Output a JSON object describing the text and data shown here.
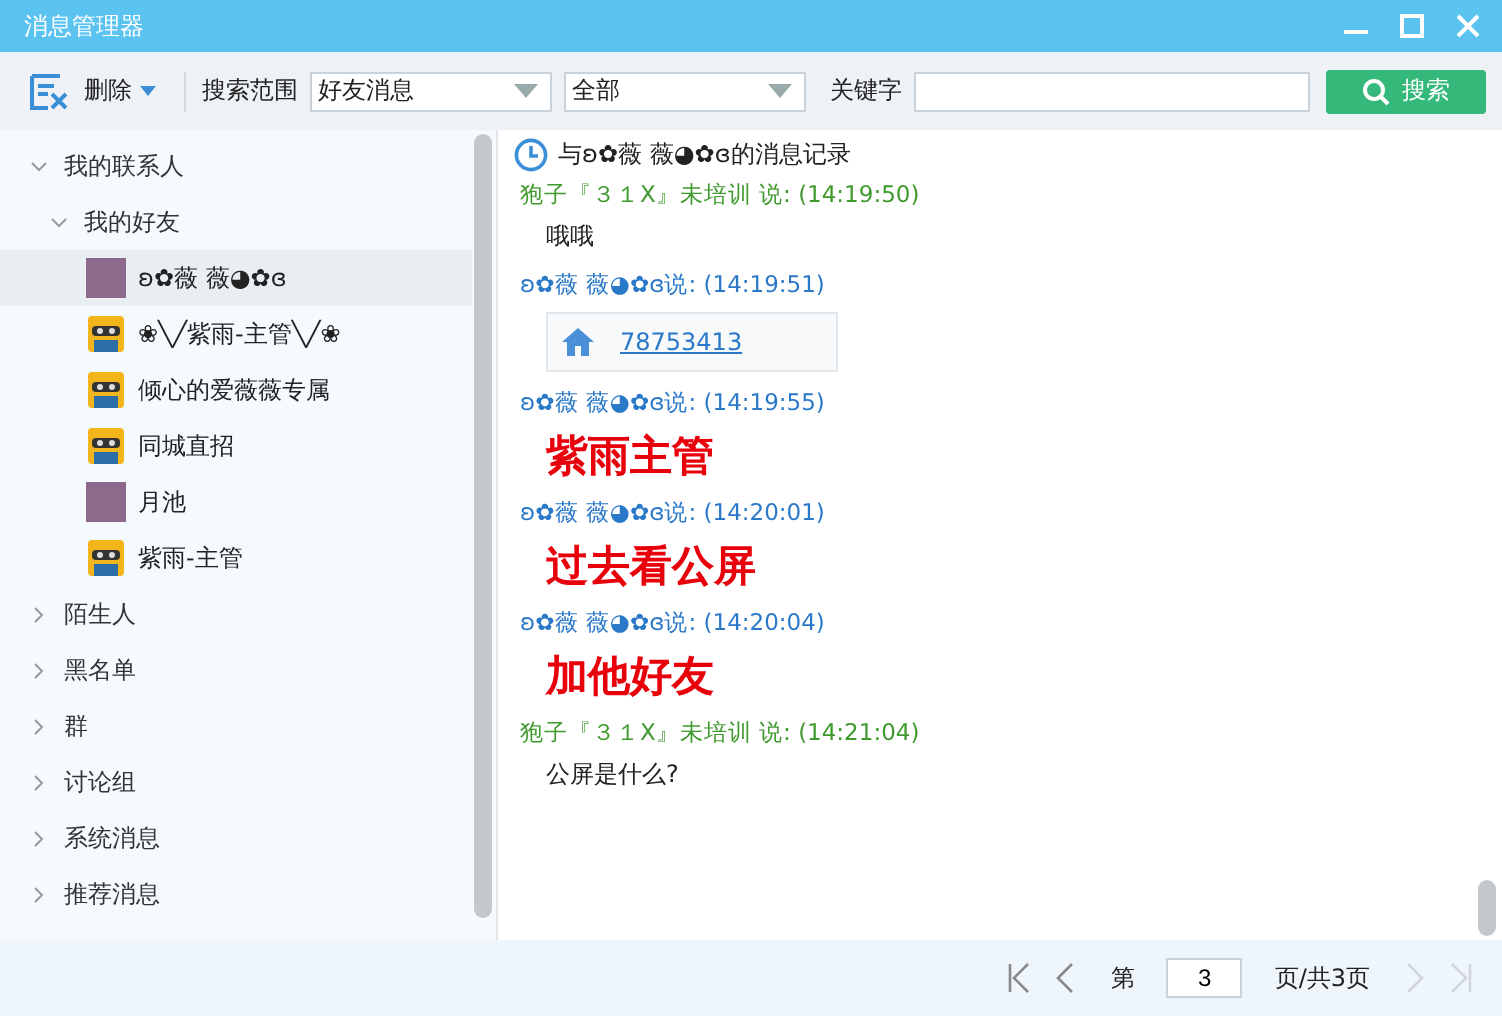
{
  "window": {
    "title": "消息管理器"
  },
  "toolbar": {
    "delete_label": "删除",
    "scope_label": "搜索范围",
    "scope_value": "好友消息",
    "filter_value": "全部",
    "keyword_label": "关键字",
    "search_button": "搜索"
  },
  "tree": [
    {
      "label": "我的联系人",
      "expanded": true,
      "children": [
        {
          "label": "我的好友",
          "expanded": true,
          "contacts": [
            {
              "name": "ʚ✿薇 薇◕✿ɞ",
              "kind": "photo",
              "selected": true
            },
            {
              "name": "❀╲╱紫雨-主管╲╱❀",
              "kind": "default",
              "selected": false
            },
            {
              "name": "倾心的爱薇薇专属",
              "kind": "default",
              "selected": false
            },
            {
              "name": "同城直招",
              "kind": "default",
              "selected": false
            },
            {
              "name": "月池",
              "kind": "photo",
              "selected": false
            },
            {
              "name": "紫雨-主管",
              "kind": "default",
              "selected": false
            }
          ]
        }
      ]
    },
    {
      "label": "陌生人",
      "expanded": false
    },
    {
      "label": "黑名单",
      "expanded": false
    },
    {
      "label": "群",
      "expanded": false
    },
    {
      "label": "讨论组",
      "expanded": false
    },
    {
      "label": "系统消息",
      "expanded": false
    },
    {
      "label": "推荐消息",
      "expanded": false
    }
  ],
  "history": {
    "title": "与ʚ✿薇 薇◕✿ɞ的消息记录",
    "messages": [
      {
        "sender": "狍子『３１X』未培训 说: (14:19:50)",
        "color": "#3f9a2e",
        "kind": "text",
        "content": "哦哦"
      },
      {
        "sender": "ʚ✿薇 薇◕✿ɞ说: (14:19:51)",
        "color": "#2a78c8",
        "kind": "link",
        "content": "78753413"
      },
      {
        "sender": "ʚ✿薇 薇◕✿ɞ说: (14:19:55)",
        "color": "#2a78c8",
        "kind": "big",
        "content": "紫雨主管"
      },
      {
        "sender": "ʚ✿薇 薇◕✿ɞ说: (14:20:01)",
        "color": "#2a78c8",
        "kind": "big",
        "content": "过去看公屏"
      },
      {
        "sender": "ʚ✿薇 薇◕✿ɞ说: (14:20:04)",
        "color": "#2a78c8",
        "kind": "big",
        "content": "加他好友"
      },
      {
        "sender": "狍子『３１X』未培训 说: (14:21:04)",
        "color": "#3f9a2e",
        "kind": "text",
        "content": "公屏是什么?"
      }
    ]
  },
  "pager": {
    "page_prefix": "第",
    "page_value": "3",
    "page_suffix": "页/共3页",
    "first_disabled": false,
    "prev_disabled": false,
    "next_disabled": true,
    "last_disabled": true
  }
}
